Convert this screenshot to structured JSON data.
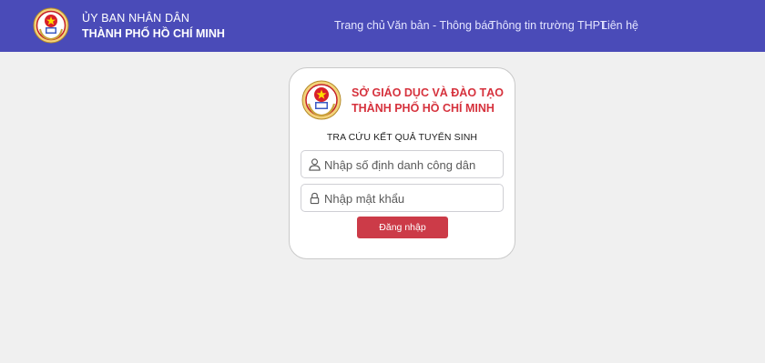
{
  "header": {
    "logo_icon": "government-emblem-icon",
    "org_line1": "ỦY BAN NHÂN DÂN",
    "org_line2": "THÀNH PHỐ HỒ CHÍ MINH",
    "nav": [
      "Trang chủ",
      "Văn bản - Thông báo",
      "Thông tin trường THPT",
      "Liên hệ"
    ]
  },
  "card": {
    "logo_icon": "education-department-emblem-icon",
    "dept_line1": "SỞ GIÁO DỤC VÀ ĐÀO TẠO",
    "dept_line2": "THÀNH PHỐ HỒ CHÍ MINH",
    "title": "TRA CỨU KẾT QUẢ TUYỂN SINH",
    "id_field": {
      "icon": "user-icon",
      "value": "",
      "placeholder": "Nhập số định danh công dân"
    },
    "password_field": {
      "icon": "lock-icon",
      "value": "",
      "placeholder": "Nhập mật khẩu"
    },
    "login_label": "Đăng nhập"
  },
  "colors": {
    "header_bg": "#4a4bb8",
    "accent_red": "#d6323d",
    "button_bg": "#cc3b48",
    "page_bg": "#f0f0f0"
  }
}
